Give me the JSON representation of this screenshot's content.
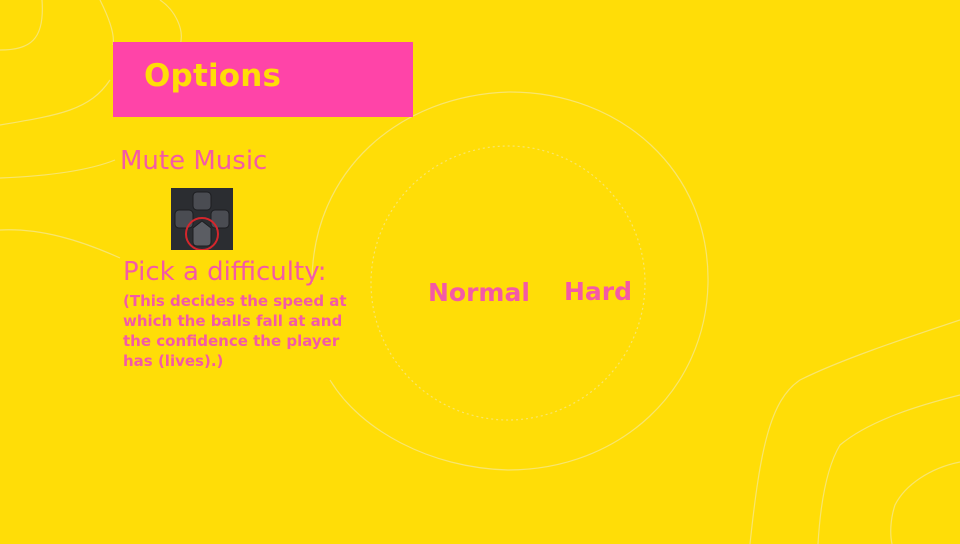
{
  "title": "Options",
  "mute_music_label": "Mute Music",
  "mute_button_icon": "dpad-bottom-button-icon",
  "difficulty": {
    "heading": "Pick a difficulty:",
    "description": "(This decides the speed at which the balls fall at and the confidence the player has (lives).)",
    "options": [
      "Normal",
      "Hard"
    ]
  },
  "colors": {
    "background": "#FFDD07",
    "accent_pink": "#FF44A8",
    "text_pink": "#F45AA6"
  }
}
